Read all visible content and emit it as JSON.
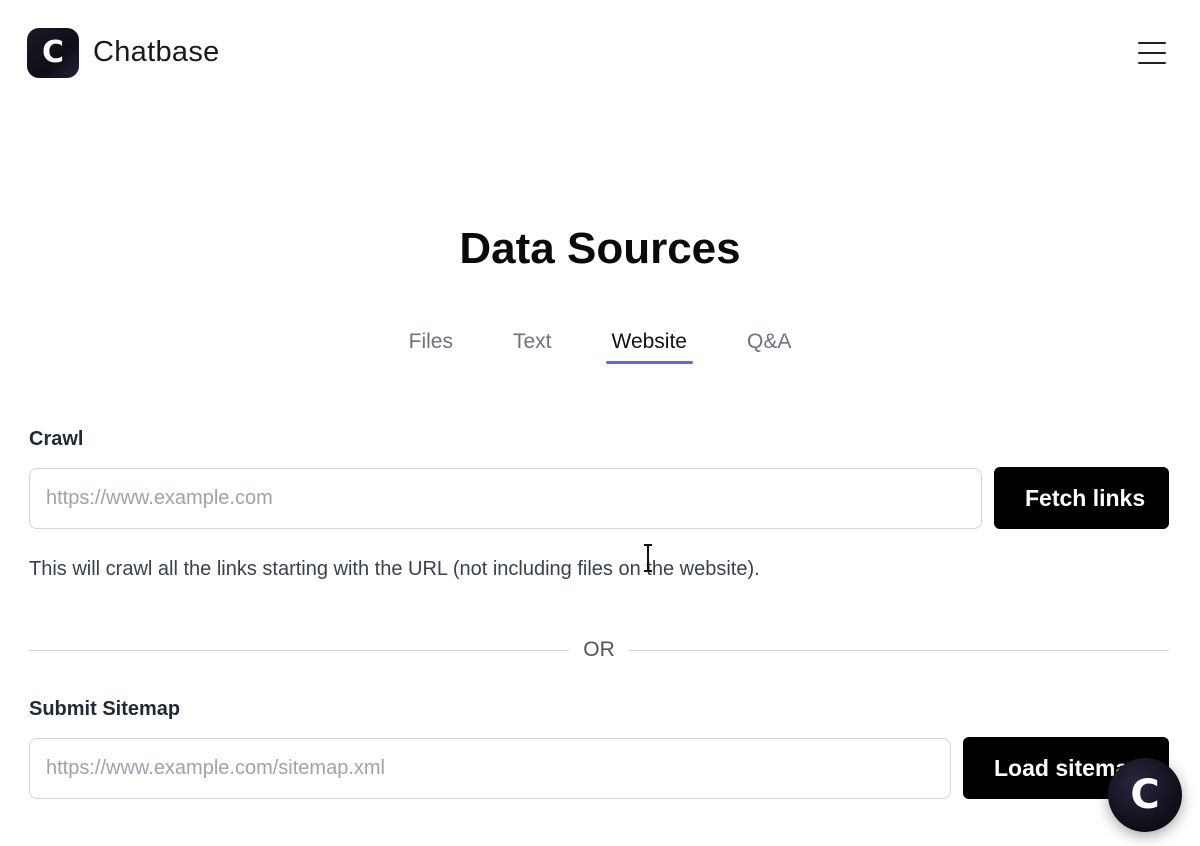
{
  "header": {
    "logo_letter": "C",
    "brand_name": "Chatbase",
    "menu_icon": "hamburger-menu-icon"
  },
  "main": {
    "title": "Data Sources",
    "tabs": [
      {
        "label": "Files",
        "active": false
      },
      {
        "label": "Text",
        "active": false
      },
      {
        "label": "Website",
        "active": true
      },
      {
        "label": "Q&A",
        "active": false
      }
    ],
    "crawl": {
      "label": "Crawl",
      "placeholder": "https://www.example.com",
      "value": "",
      "button_label": "Fetch links",
      "help_text": "This will crawl all the links starting with the URL (not including files on the website)."
    },
    "divider_text": "OR",
    "sitemap": {
      "label": "Submit Sitemap",
      "placeholder": "https://www.example.com/sitemap.xml",
      "value": "",
      "button_label": "Load sitemap"
    }
  },
  "chat_bubble": {
    "letter": "C"
  },
  "colors": {
    "tab_underline": "#6366f1",
    "button_bg": "#000000",
    "muted_text": "#6b7280"
  }
}
